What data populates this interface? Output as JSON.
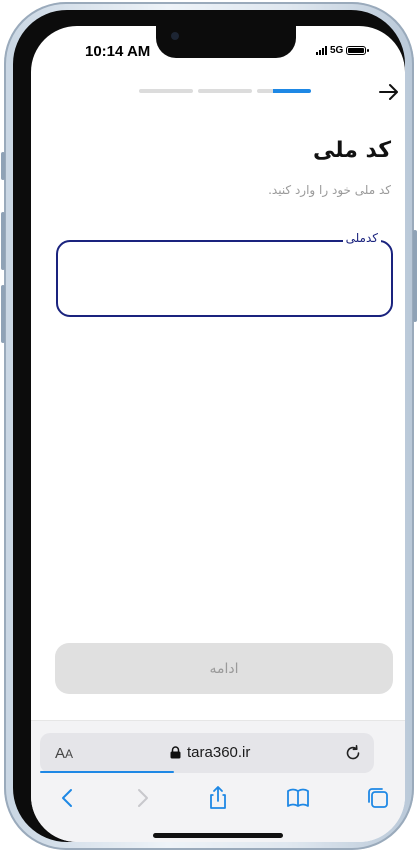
{
  "status": {
    "time": "10:14 AM",
    "network": "5G"
  },
  "icons": {
    "back": "arrow-right-icon",
    "lock": "lock-icon",
    "reload": "reload-icon",
    "nav_back": "chevron-left-icon",
    "nav_forward": "chevron-right-icon",
    "share": "share-icon",
    "bookmarks": "book-icon",
    "tabs": "tabs-icon"
  },
  "progress": {
    "total_steps": 3,
    "current_step": 3
  },
  "form": {
    "title": "کد ملی",
    "subtitle": "کد ملی خود را وارد کنید.",
    "field_label": "کدملی",
    "field_value": ""
  },
  "actions": {
    "continue_label": "ادامه"
  },
  "browser": {
    "text_size_label_big": "A",
    "text_size_label_small": "A",
    "url": "tara360.ir"
  },
  "colors": {
    "accent": "#1e88e5",
    "field_border": "#1a237e",
    "button_disabled_bg": "#e0e0e0",
    "button_disabled_text": "#9a9a9a"
  }
}
